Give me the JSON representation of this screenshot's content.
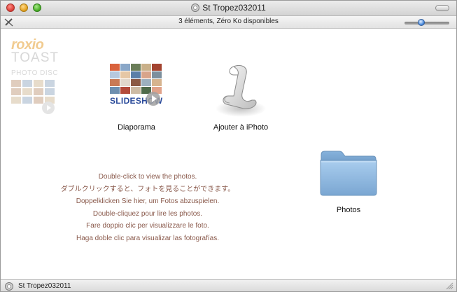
{
  "window": {
    "title": "St Tropez032011"
  },
  "status": {
    "text": "3 éléments, Zéro Ko disponibles"
  },
  "branding": {
    "roxio": "roxio",
    "toast": "TOAST",
    "photo_disc": "PHOTO DISC"
  },
  "items": {
    "slideshow": {
      "label": "Diaporama",
      "badge": "SLIDESHOW"
    },
    "iphoto": {
      "label": "Ajouter à iPhoto"
    },
    "photos": {
      "label": "Photos"
    }
  },
  "instructions": [
    "Double-click to view the photos.",
    "ダブルクリックすると、フォトを見ることができます。",
    "Doppelklicken Sie hier, um Fotos abzuspielen.",
    "Double-cliquez pour lire les photos.",
    "Fare doppio clic per visualizzare le foto.",
    "Haga doble clic para visualizar las fotografías."
  ],
  "bottombar": {
    "path": "St Tropez032011"
  },
  "colors": {
    "instruction_text": "#8a5a4c",
    "slideshow_text": "#2a4a9a",
    "folder_blue": "#8fb8df"
  }
}
